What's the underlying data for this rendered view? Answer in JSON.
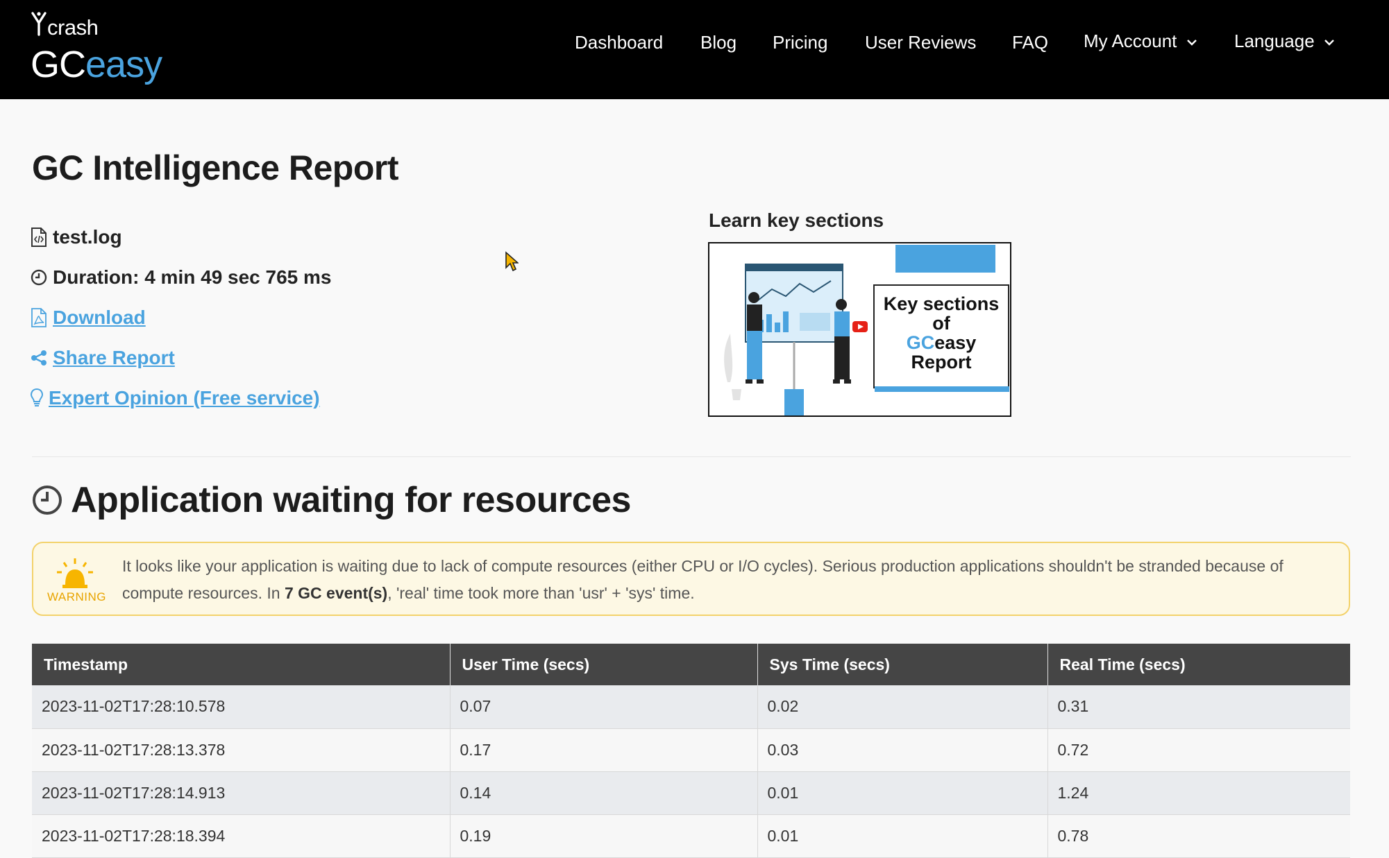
{
  "brand": {
    "crash": "crash",
    "gc": "GC",
    "easy": "easy"
  },
  "nav": {
    "dashboard": "Dashboard",
    "blog": "Blog",
    "pricing": "Pricing",
    "user_reviews": "User Reviews",
    "faq": "FAQ",
    "my_account": "My Account",
    "language": "Language"
  },
  "report": {
    "title": "GC Intelligence Report",
    "filename": "test.log",
    "duration": "Duration: 4 min 49 sec 765 ms",
    "download": "Download",
    "share": "Share Report",
    "expert": "Expert Opinion (Free service)"
  },
  "learn": {
    "title": "Learn key sections",
    "card_line1": "Key sections",
    "card_line2": "of",
    "card_gc": "GC",
    "card_easy": "easy",
    "card_line4": "Report"
  },
  "section": {
    "title": "Application waiting for resources",
    "warning_label": "WARNING",
    "warning_text_1": "It looks like your application is waiting due to lack of compute resources (either CPU or I/O cycles). Serious production applications shouldn't be stranded because of compute resources. In ",
    "warning_bold": "7 GC event(s)",
    "warning_text_2": ", 'real' time took more than 'usr' + 'sys' time."
  },
  "table": {
    "headers": [
      "Timestamp",
      "User Time (secs)",
      "Sys Time (secs)",
      "Real Time (secs)"
    ],
    "rows": [
      [
        "2023-11-02T17:28:10.578",
        "0.07",
        "0.02",
        "0.31"
      ],
      [
        "2023-11-02T17:28:13.378",
        "0.17",
        "0.03",
        "0.72"
      ],
      [
        "2023-11-02T17:28:14.913",
        "0.14",
        "0.01",
        "1.24"
      ],
      [
        "2023-11-02T17:28:18.394",
        "0.19",
        "0.01",
        "0.78"
      ]
    ]
  },
  "colors": {
    "nav_bg": "#000000",
    "accent": "#4aa3df",
    "warning_border": "#f3d26b",
    "warning_bg": "#fdf8e4",
    "table_header": "#454545"
  }
}
